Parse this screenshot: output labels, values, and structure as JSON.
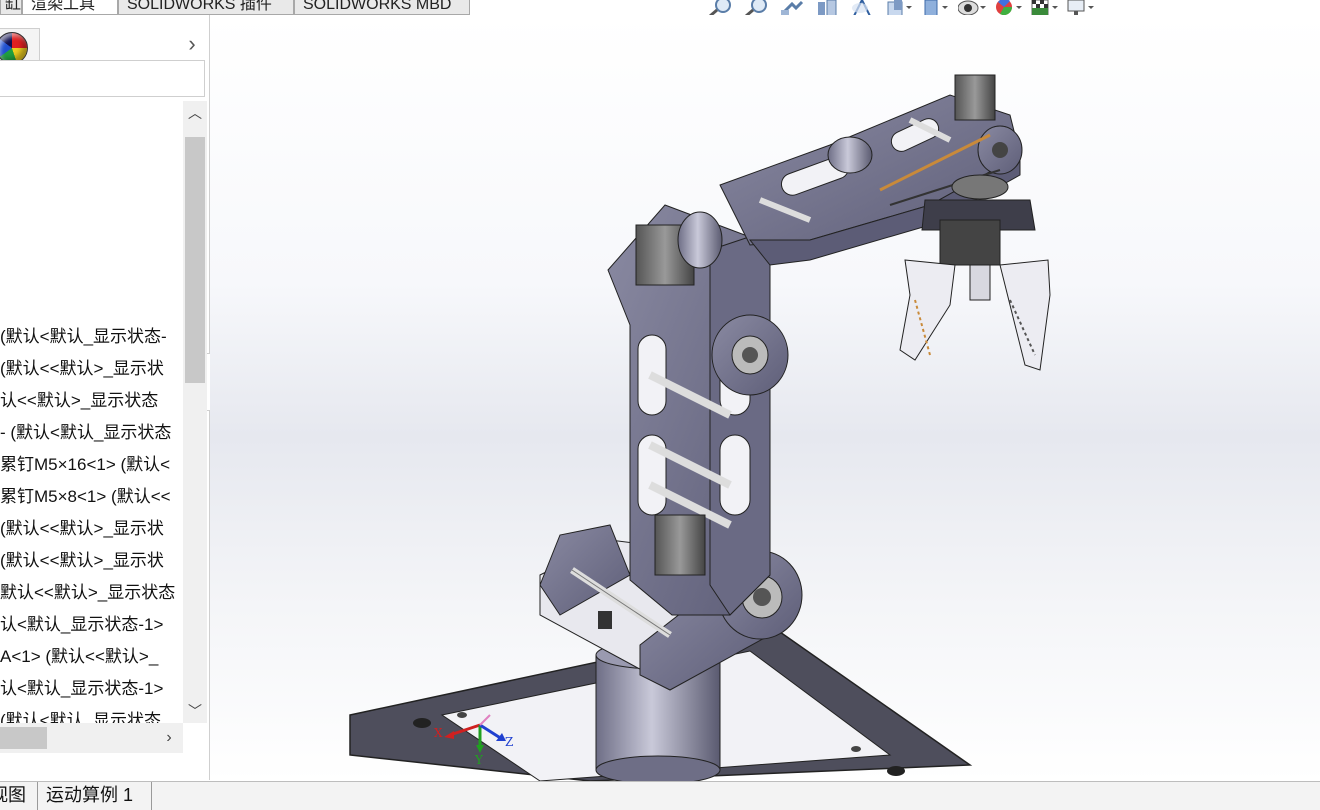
{
  "top_tabs": [
    {
      "label": "缸"
    },
    {
      "label": "渲染工具"
    },
    {
      "label": "SOLIDWORKS 插件"
    },
    {
      "label": "SOLIDWORKS MBD"
    }
  ],
  "toolbar": {
    "icons": [
      "zoom-to-fit-icon",
      "zoom-area-icon",
      "previous-view-icon",
      "section-view-icon",
      "dynamic-annotation-icon",
      "view-orientation-icon",
      "display-style-icon",
      "hide-show-items-icon",
      "edit-appearance-icon",
      "apply-scene-icon",
      "view-settings-icon"
    ]
  },
  "left_panel": {
    "expand_icon": "chevron-right-icon",
    "tree_items": [
      "(默认<默认_显示状态-",
      "(默认<<默认>_显示状",
      "认<<默认>_显示状态 ",
      "- (默认<默认_显示状态",
      "累钉M5×16<1> (默认<",
      "累钉M5×8<1> (默认<<",
      "(默认<<默认>_显示状",
      "(默认<<默认>_显示状",
      "默认<<默认>_显示状态",
      "认<默认_显示状态-1>",
      "A<1> (默认<<默认>_",
      "认<默认_显示状态-1>",
      "(默认<默认_显示状态"
    ]
  },
  "triad": {
    "x": "X",
    "y": "Y",
    "z": "Z"
  },
  "bottom_tabs": [
    {
      "label": "视图"
    },
    {
      "label": "运动算例 1"
    }
  ]
}
